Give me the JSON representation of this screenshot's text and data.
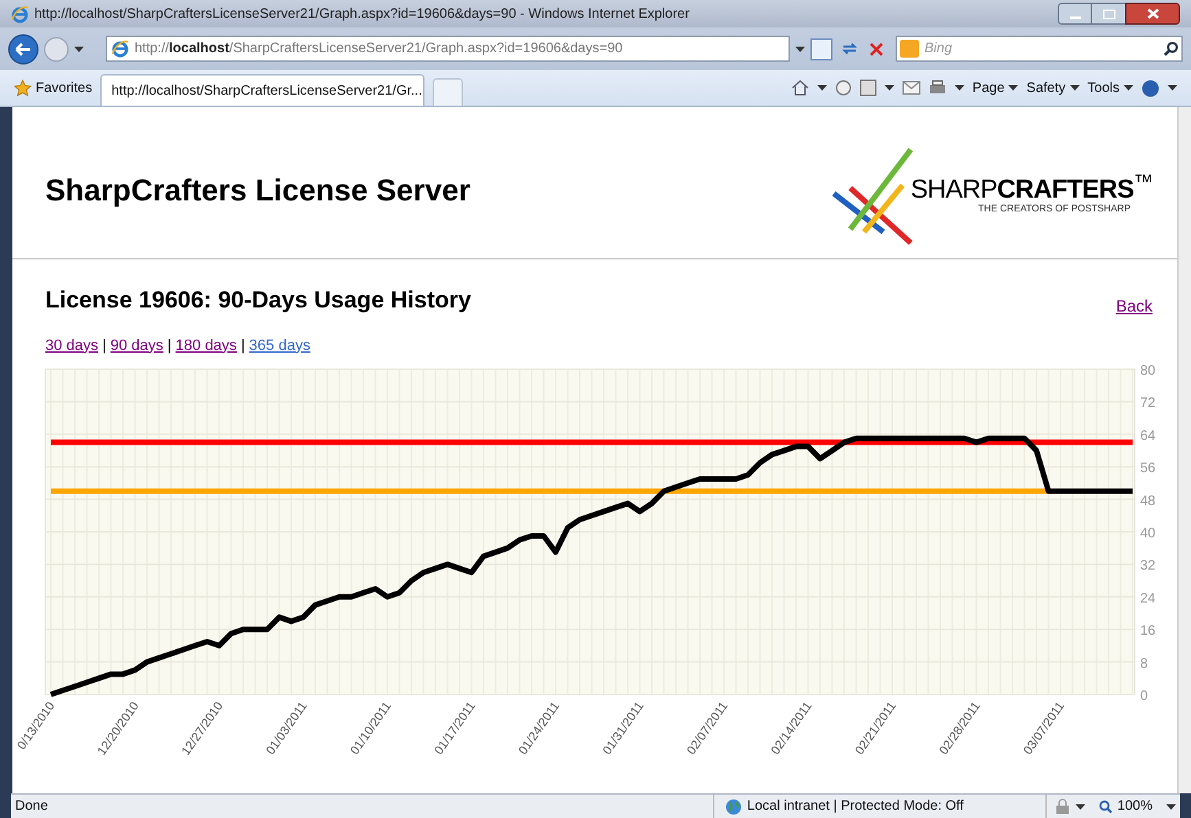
{
  "window": {
    "title": "http://localhost/SharpCraftersLicenseServer21/Graph.aspx?id=19606&days=90 - Windows Internet Explorer"
  },
  "address_bar": {
    "url_prefix": "http://",
    "url_host": "localhost",
    "url_path": "/SharpCraftersLicenseServer21/Graph.aspx?id=19606&days=90",
    "search_placeholder": "Bing"
  },
  "favorites_bar": {
    "favorites": "Favorites",
    "tab_title": "http://localhost/SharpCraftersLicenseServer21/Gr...",
    "menus": [
      "Page",
      "Safety",
      "Tools"
    ]
  },
  "page": {
    "title": "SharpCrafters License Server",
    "logo": {
      "wordmark": "SHARP**CRAFTERS**$^{™}$",
      "tagline": "THE CREATORS OF POSTSHARP"
    },
    "heading": "License 19606: 90-Days Usage History",
    "back_link": "Back",
    "range_links": [
      {
        "label": "30 days",
        "visited": true
      },
      {
        "label": "90 days",
        "visited": true
      },
      {
        "label": "180 days",
        "visited": true
      },
      {
        "label": "365 days",
        "visited": false
      }
    ],
    "range_separators": [
      "|",
      "|",
      "|"
    ],
    "chart_data": {
      "type": "line",
      "categories": [
        "0/13/2010",
        null,
        null,
        null,
        null,
        null,
        null,
        "12/20/2010",
        null,
        null,
        null,
        null,
        null,
        null,
        "12/27/2010",
        null,
        null,
        null,
        null,
        null,
        null,
        "01/03/2011",
        null,
        null,
        null,
        null,
        null,
        null,
        "01/10/2011",
        null,
        null,
        null,
        null,
        null,
        null,
        "01/17/2011",
        null,
        null,
        null,
        null,
        null,
        null,
        "01/24/2011",
        null,
        null,
        null,
        null,
        null,
        null,
        "01/31/2011",
        null,
        null,
        null,
        null,
        null,
        null,
        "02/07/2011",
        null,
        null,
        null,
        null,
        null,
        null,
        "02/14/2011",
        null,
        null,
        null,
        null,
        null,
        null,
        "02/21/2011",
        null,
        null,
        null,
        null,
        null,
        null,
        "02/28/2011",
        null,
        null,
        null,
        null,
        null,
        null,
        "03/07/2011",
        null,
        null,
        null,
        null,
        null,
        null
      ],
      "series": [
        {
          "color": "#ff0000",
          "values": [
            62,
            62,
            62,
            62,
            62,
            62,
            62,
            62,
            62,
            62,
            62,
            62,
            62,
            62,
            62,
            62,
            62,
            62,
            62,
            62,
            62,
            62,
            62,
            62,
            62,
            62,
            62,
            62,
            62,
            62,
            62,
            62,
            62,
            62,
            62,
            62,
            62,
            62,
            62,
            62,
            62,
            62,
            62,
            62,
            62,
            62,
            62,
            62,
            62,
            62,
            62,
            62,
            62,
            62,
            62,
            62,
            62,
            62,
            62,
            62,
            62,
            62,
            62,
            62,
            62,
            62,
            62,
            62,
            62,
            62,
            62,
            62,
            62,
            62,
            62,
            62,
            62,
            62,
            62,
            62,
            62,
            62,
            62,
            62,
            62,
            62,
            62,
            62,
            62,
            62,
            62
          ]
        },
        {
          "color": "#ffa500",
          "values": [
            50,
            50,
            50,
            50,
            50,
            50,
            50,
            50,
            50,
            50,
            50,
            50,
            50,
            50,
            50,
            50,
            50,
            50,
            50,
            50,
            50,
            50,
            50,
            50,
            50,
            50,
            50,
            50,
            50,
            50,
            50,
            50,
            50,
            50,
            50,
            50,
            50,
            50,
            50,
            50,
            50,
            50,
            50,
            50,
            50,
            50,
            50,
            50,
            50,
            50,
            50,
            50,
            50,
            50,
            50,
            50,
            50,
            50,
            50,
            50,
            50,
            50,
            50,
            50,
            50,
            50,
            50,
            50,
            50,
            50,
            50,
            50,
            50,
            50,
            50,
            50,
            50,
            50,
            50,
            50,
            50,
            50,
            50,
            50,
            null,
            null,
            null,
            null,
            null,
            null,
            null
          ]
        },
        {
          "color": "#000000",
          "values": [
            0,
            1,
            2,
            3,
            4,
            5,
            5,
            6,
            8,
            9,
            10,
            11,
            12,
            13,
            12,
            15,
            16,
            16,
            16,
            19,
            18,
            19,
            22,
            23,
            24,
            24,
            25,
            26,
            24,
            25,
            28,
            30,
            31,
            32,
            31,
            30,
            34,
            35,
            36,
            38,
            39,
            39,
            35,
            41,
            43,
            44,
            45,
            46,
            47,
            45,
            47,
            50,
            51,
            52,
            53,
            53,
            53,
            53,
            54,
            57,
            59,
            60,
            61,
            61,
            58,
            60,
            62,
            63,
            63,
            63,
            63,
            63,
            63,
            63,
            63,
            63,
            63,
            62,
            63,
            63,
            63,
            63,
            60,
            50,
            50,
            50,
            50,
            50,
            50,
            50,
            50
          ]
        }
      ],
      "grid": true,
      "ylim": [
        0,
        80
      ],
      "yticks": [
        0,
        8,
        16,
        24,
        32,
        40,
        48,
        56,
        64,
        72,
        80
      ]
    }
  },
  "status_bar": {
    "status": "Done",
    "zone": "Local intranet | Protected Mode: Off",
    "zoom": "100%"
  }
}
